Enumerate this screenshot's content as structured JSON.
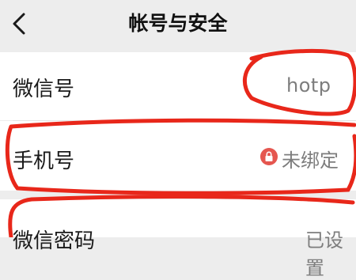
{
  "header": {
    "title": "帐号与安全",
    "back_icon": "chevron-left-icon"
  },
  "rows": [
    {
      "label": "微信号",
      "value": "hotp"
    },
    {
      "label": "手机号",
      "value": "未绑定",
      "icon": "lock-icon",
      "icon_color": "#e5564f"
    },
    {
      "label": "微信密码",
      "value": "已设置"
    }
  ],
  "annotation_color": "#e8271a"
}
